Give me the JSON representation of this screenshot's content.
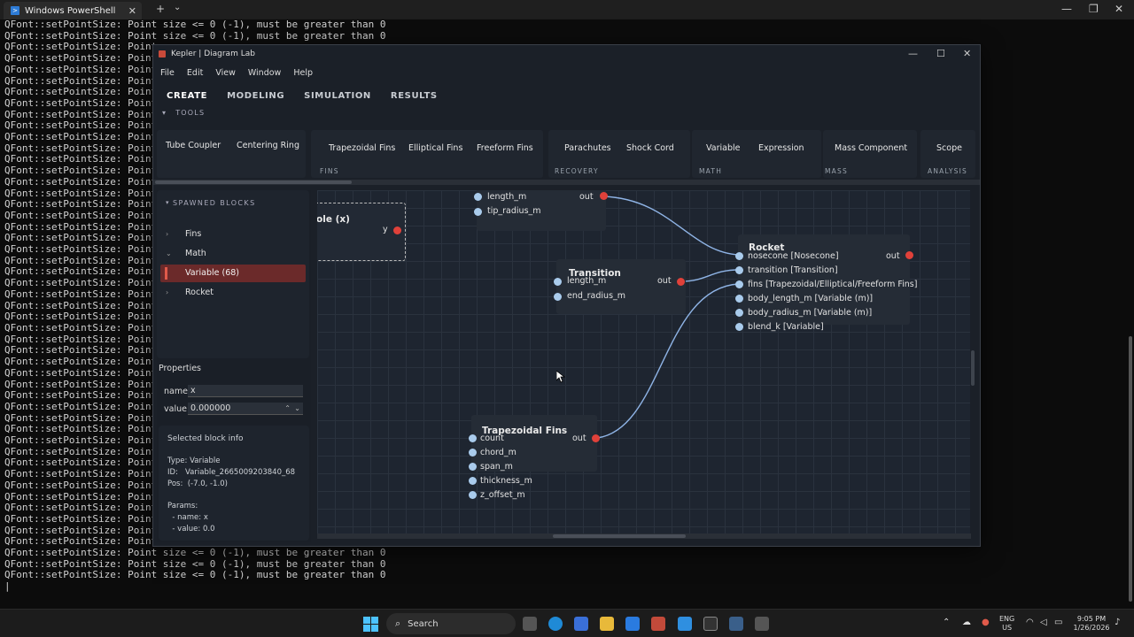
{
  "powershell": {
    "tab_title": "Windows PowerShell",
    "tab_icon": "powershell-icon",
    "new_tab": "+",
    "dropdown": "⌄",
    "close": "✕",
    "console_lines": [
      "QFont::setPointSize: Point size <= 0 (-1), must be greater than 0",
      "QFont::setPointSize: Point size <= 0 (-1), must be greater than 0",
      "QFont::setPointSize: Point s",
      "QFont::setPointSize: Point s",
      "QFont::setPointSize: Point s",
      "QFont::setPointSize: Point s",
      "QFont::setPointSize: Point s",
      "QFont::setPointSize: Point s",
      "QFont::setPointSize: Point s",
      "QFont::setPointSize: Point s",
      "QFont::setPointSize: Point s",
      "QFont::setPointSize: Point s",
      "QFont::setPointSize: Point s",
      "QFont::setPointSize: Point s",
      "QFont::setPointSize: Point s",
      "QFont::setPointSize: Point s",
      "QFont::setPointSize: Point s",
      "QFont::setPointSize: Point s",
      "QFont::setPointSize: Point s",
      "QFont::setPointSize: Point s",
      "QFont::setPointSize: Point s",
      "QFont::setPointSize: Point s",
      "QFont::setPointSize: Point s",
      "QFont::setPointSize: Point s",
      "QFont::setPointSize: Point s",
      "QFont::setPointSize: Point s",
      "QFont::setPointSize: Point s",
      "QFont::setPointSize: Point s",
      "QFont::setPointSize: Point s",
      "QFont::setPointSize: Point s",
      "QFont::setPointSize: Point s",
      "QFont::setPointSize: Point s",
      "QFont::setPointSize: Point s",
      "QFont::setPointSize: Point s",
      "QFont::setPointSize: Point s",
      "QFont::setPointSize: Point s",
      "QFont::setPointSize: Point s",
      "QFont::setPointSize: Point s",
      "QFont::setPointSize: Point s",
      "QFont::setPointSize: Point s",
      "QFont::setPointSize: Point s",
      "QFont::setPointSize: Point s",
      "QFont::setPointSize: Point s",
      "QFont::setPointSize: Point s",
      "QFont::setPointSize: Point s",
      "QFont::setPointSize: Point s",
      "QFont::setPointSize: Point s",
      "QFont::setPointSize: Point size <= 0 (-1), must be greater than 0",
      "QFont::setPointSize: Point size <= 0 (-1), must be greater than 0",
      "QFont::setPointSize: Point size <= 0 (-1), must be greater than 0",
      "|"
    ]
  },
  "kepler": {
    "title": "Kepler | Diagram Lab",
    "menu": [
      "File",
      "Edit",
      "View",
      "Window",
      "Help"
    ],
    "tabs": [
      "CREATE",
      "MODELING",
      "SIMULATION",
      "RESULTS"
    ],
    "tools_label": "TOOLS",
    "ribbon": {
      "partial_items": [
        "Tube Coupler",
        "Centering Ring"
      ],
      "fins_items": [
        "Trapezoidal Fins",
        "Elliptical Fins",
        "Freeform Fins"
      ],
      "fins_label": "FINS",
      "recovery_items": [
        "Parachutes",
        "Shock Cord"
      ],
      "recovery_label": "RECOVERY",
      "math_items": [
        "Variable",
        "Expression"
      ],
      "math_label": "MATH",
      "mass_items": [
        "Mass Component"
      ],
      "mass_label": "MASS",
      "analysis_items": [
        "Scope"
      ],
      "analysis_label": "ANALYSIS"
    },
    "spawned": {
      "header": "SPAWNED BLOCKS",
      "items": [
        "Fins",
        "Math",
        "Variable  (68)",
        "Rocket"
      ]
    },
    "properties": {
      "header": "Properties",
      "name_label": "name",
      "name_value": "x",
      "value_label": "value",
      "value_value": "0.000000"
    },
    "selected_info": {
      "header": "Selected block info",
      "type": "Type: Variable",
      "id": "ID:   Variable_2665009203840_68",
      "pos": "Pos:  (-7.0, -1.0)",
      "params": "Params:",
      "param_name": "  - name: x",
      "param_value": "  - value: 0.0"
    },
    "nodes": {
      "variable": {
        "title": "ole (x)",
        "out": "y"
      },
      "nosecone_partial": {
        "ports": [
          "length_m",
          "tip_radius_m"
        ],
        "out": "out"
      },
      "transition": {
        "title": "Transition",
        "ports": [
          "length_m",
          "end_radius_m"
        ],
        "out": "out"
      },
      "rocket": {
        "title": "Rocket",
        "ports": [
          "nosecone [Nosecone]",
          "transition [Transition]",
          "fins [Trapezoidal/Elliptical/Freeform Fins]",
          "body_length_m [Variable (m)]",
          "body_radius_m [Variable (m)]",
          "blend_k [Variable]"
        ],
        "out": "out"
      },
      "trapezoidal": {
        "title": "Trapezoidal Fins",
        "ports": [
          "count",
          "chord_m",
          "span_m",
          "thickness_m",
          "z_offset_m"
        ],
        "out": "out"
      }
    }
  },
  "taskbar": {
    "search": "Search",
    "lang": "ENG",
    "region": "US",
    "time": "9:05 PM",
    "date": "1/26/2026"
  },
  "colors": {
    "accent_red": "#e0413a",
    "pin_blue": "#a9cbec",
    "wire": "#8fb4e6",
    "selection": "#6b2a2a"
  }
}
